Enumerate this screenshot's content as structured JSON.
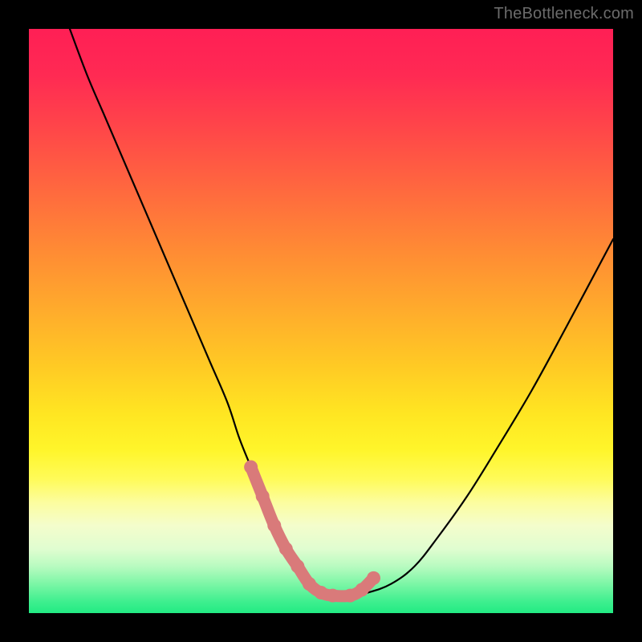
{
  "watermark": "TheBottleneck.com",
  "chart_data": {
    "type": "line",
    "title": "",
    "xlabel": "",
    "ylabel": "",
    "xlim": [
      0,
      100
    ],
    "ylim": [
      0,
      100
    ],
    "series": [
      {
        "name": "bottleneck-curve",
        "x": [
          7,
          10,
          13,
          16,
          19,
          22,
          25,
          28,
          31,
          34,
          36,
          38,
          40,
          42,
          44,
          46,
          48,
          50,
          52,
          55,
          58,
          62,
          66,
          70,
          75,
          80,
          86,
          92,
          100
        ],
        "y": [
          100,
          92,
          85,
          78,
          71,
          64,
          57,
          50,
          43,
          36,
          30,
          25,
          20,
          15,
          11,
          8,
          5,
          3.5,
          3,
          3,
          3.5,
          5,
          8,
          13,
          20,
          28,
          38,
          49,
          64
        ]
      }
    ],
    "highlight": {
      "name": "optimal-zone-markers",
      "color": "#d97a7a",
      "points_x": [
        38,
        40,
        42,
        44,
        46,
        48,
        50,
        52,
        55,
        57,
        59
      ],
      "points_y": [
        25,
        20,
        15,
        11,
        8,
        5,
        3.5,
        3,
        3,
        4,
        6
      ]
    }
  }
}
